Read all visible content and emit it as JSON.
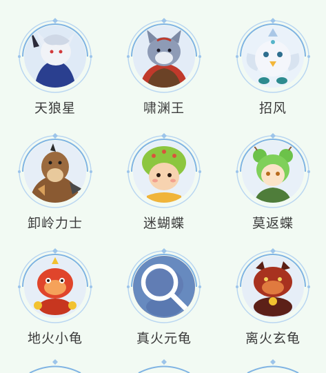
{
  "colors": {
    "background": "#f2faf3",
    "ring": "#7fb3e3",
    "ring_light": "#b9d6f1",
    "label": "#3b3b3b",
    "selected_overlay": "#4e8ad2"
  },
  "pets": [
    {
      "name": "天狼星",
      "icon": "wolf-knight-portrait"
    },
    {
      "name": "啸渊王",
      "icon": "gray-wolf-portrait"
    },
    {
      "name": "招风",
      "icon": "white-bird-portrait"
    },
    {
      "name": "卸岭力士",
      "icon": "brown-beast-portrait"
    },
    {
      "name": "迷蝴蝶",
      "icon": "green-hat-girl-portrait"
    },
    {
      "name": "莫返蝶",
      "icon": "green-hair-girl-portrait"
    },
    {
      "name": "地火小龟",
      "icon": "red-turtle-portrait"
    },
    {
      "name": "真火元龟",
      "icon": "search-icon",
      "selected": true
    },
    {
      "name": "离火玄龟",
      "icon": "dark-red-turtle-portrait"
    }
  ]
}
